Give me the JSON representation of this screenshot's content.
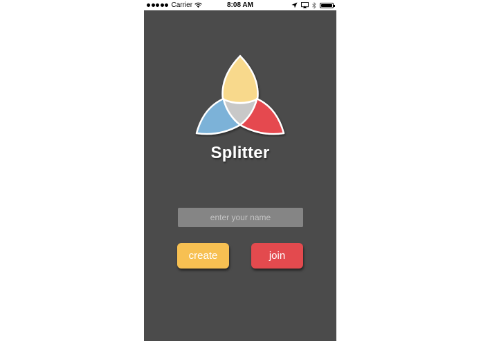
{
  "status_bar": {
    "carrier": "Carrier",
    "time": "8:08 AM",
    "signal_icon": "signal-dots-icon",
    "wifi_icon": "wifi-icon",
    "location_icon": "location-arrow-icon",
    "airplay_icon": "airplay-icon",
    "bluetooth_icon": "bluetooth-icon",
    "battery_icon": "battery-icon",
    "battery_level": 1.0
  },
  "app": {
    "title": "Splitter",
    "logo_colors": {
      "top": "#f8d98c",
      "left": "#7bb2d8",
      "right": "#e5494f",
      "center": "#c8c8c8"
    }
  },
  "form": {
    "name_placeholder": "enter your name",
    "name_value": "",
    "create_label": "create",
    "join_label": "join"
  },
  "colors": {
    "background": "#4b4b4b",
    "create_button": "#f7c052",
    "join_button": "#e34a4e",
    "input_background": "#858585"
  }
}
